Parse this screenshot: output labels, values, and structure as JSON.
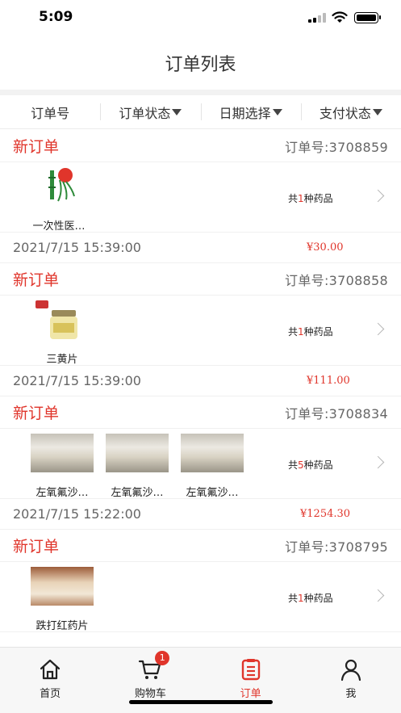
{
  "status_bar": {
    "time": "5:09"
  },
  "header": {
    "title": "订单列表"
  },
  "filters": [
    {
      "label": "订单号",
      "has_dropdown": false
    },
    {
      "label": "订单状态",
      "has_dropdown": true
    },
    {
      "label": "日期选择",
      "has_dropdown": true
    },
    {
      "label": "支付状态",
      "has_dropdown": true
    }
  ],
  "orders": [
    {
      "status": "新订单",
      "order_no": "订单号:3708859",
      "products": [
        {
          "name": "一次性医…",
          "icon": "bamboo-logo"
        }
      ],
      "count_prefix": "共",
      "count": "1",
      "count_suffix": "种药品",
      "time": "2021/7/15 15:39:00",
      "total": "¥30.00"
    },
    {
      "status": "新订单",
      "order_no": "订单号:3708858",
      "products": [
        {
          "name": "三黄片",
          "icon": "medicine-bottle"
        }
      ],
      "count_prefix": "共",
      "count": "1",
      "count_suffix": "种药品",
      "time": "2021/7/15 15:39:00",
      "total": "¥111.00"
    },
    {
      "status": "新订单",
      "order_no": "订单号:3708834",
      "products": [
        {
          "name": "左氧氟沙…",
          "icon": "product-photo"
        },
        {
          "name": "左氧氟沙…",
          "icon": "product-photo"
        },
        {
          "name": "左氧氟沙…",
          "icon": "product-photo"
        }
      ],
      "count_prefix": "共",
      "count": "5",
      "count_suffix": "种药品",
      "time": "2021/7/15 15:22:00",
      "total": "¥1254.30"
    },
    {
      "status": "新订单",
      "order_no": "订单号:3708795",
      "products": [
        {
          "name": "跌打红药片",
          "icon": "medicine-pack"
        }
      ],
      "count_prefix": "共",
      "count": "1",
      "count_suffix": "种药品"
    }
  ],
  "tabbar": {
    "items": [
      {
        "label": "首页",
        "icon": "home-icon"
      },
      {
        "label": "购物车",
        "icon": "cart-icon",
        "badge": "1"
      },
      {
        "label": "订单",
        "icon": "order-icon",
        "active": true
      },
      {
        "label": "我",
        "icon": "user-icon"
      }
    ]
  },
  "colors": {
    "accent": "#e0352b",
    "text": "#333333",
    "muted": "#666666"
  }
}
